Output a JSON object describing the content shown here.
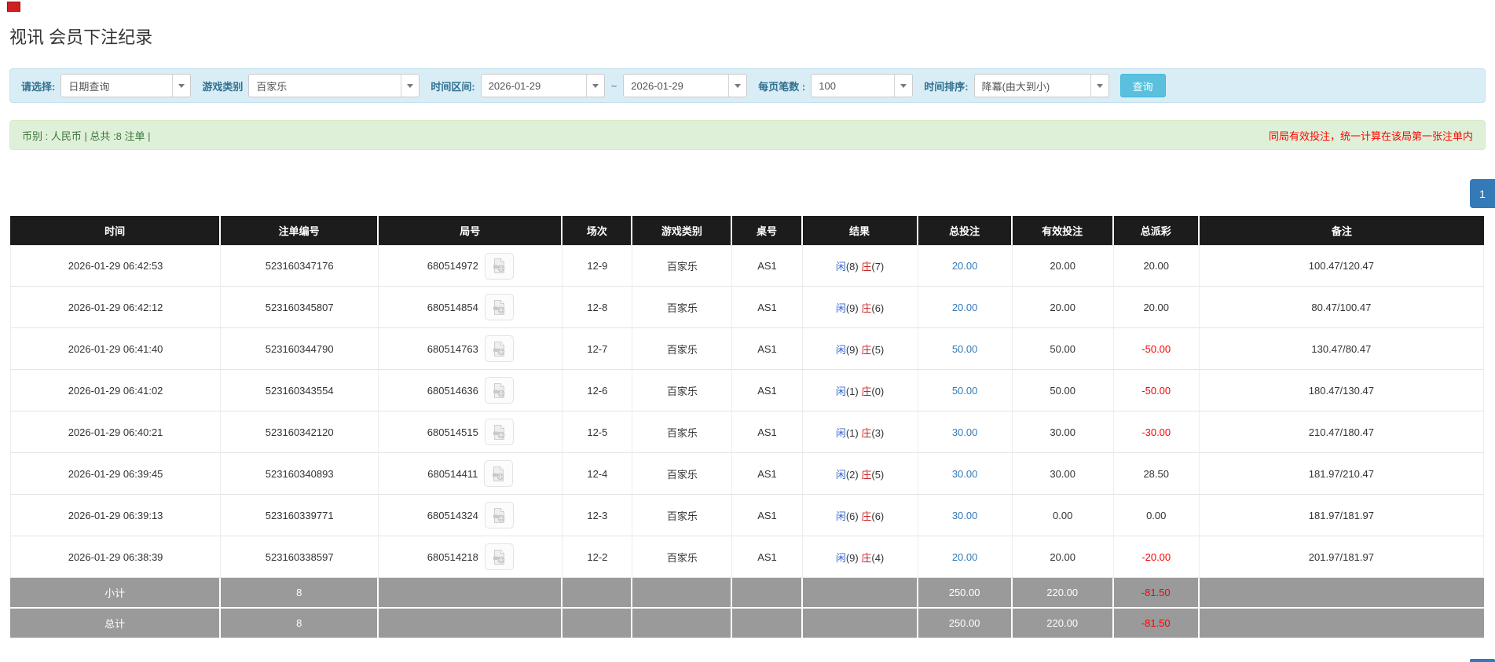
{
  "page": {
    "title": "视讯 会员下注纪录"
  },
  "colors": {
    "accent_blue": "#337ab7",
    "query_button_blue": "#5bc0de",
    "filterbar_bg": "#d9edf7",
    "infobar_bg": "#dff0d8",
    "header_bg": "#1c1c1c",
    "sum_row_gray": "#9a9a9a",
    "negative_red": "#ff0000",
    "player_blue": "#3366cc",
    "banker_red": "#cc2222"
  },
  "filters": {
    "select_label": "请选择:",
    "select_value": "日期查询",
    "game_label": "游戏类别",
    "game_value": "百家乐",
    "range_label": "时间区间:",
    "date_from": "2026-01-29",
    "tilde": "~",
    "date_to": "2026-01-29",
    "per_page_label": "每页笔数 :",
    "per_page_value": "100",
    "sort_label": "时间排序:",
    "sort_value": "降冪(由大到小)",
    "query_button": "查询"
  },
  "summary_bar": {
    "left": "币别 : 人民币 | 总共 :8 注单 |",
    "right": "同局有效投注，统一计算在该局第一张注单内"
  },
  "pagination": {
    "page": "1"
  },
  "table": {
    "headers": [
      "时间",
      "注单编号",
      "局号",
      "场次",
      "游戏类别",
      "桌号",
      "结果",
      "总投注",
      "有效投注",
      "总派彩",
      "备注"
    ],
    "rows": [
      {
        "time": "2026-01-29 06:42:53",
        "bet_id": "523160347176",
        "round_id": "680514972",
        "session": "12-9",
        "game": "百家乐",
        "table_no": "AS1",
        "result_player": "闲",
        "result_player_score": "(8)",
        "result_banker": "庄",
        "result_banker_score": "(7)",
        "total_bet": "20.00",
        "valid_bet": "20.00",
        "payout": "20.00",
        "remark": "100.47/120.47"
      },
      {
        "time": "2026-01-29 06:42:12",
        "bet_id": "523160345807",
        "round_id": "680514854",
        "session": "12-8",
        "game": "百家乐",
        "table_no": "AS1",
        "result_player": "闲",
        "result_player_score": "(9)",
        "result_banker": "庄",
        "result_banker_score": "(6)",
        "total_bet": "20.00",
        "valid_bet": "20.00",
        "payout": "20.00",
        "remark": "80.47/100.47"
      },
      {
        "time": "2026-01-29 06:41:40",
        "bet_id": "523160344790",
        "round_id": "680514763",
        "session": "12-7",
        "game": "百家乐",
        "table_no": "AS1",
        "result_player": "闲",
        "result_player_score": "(9)",
        "result_banker": "庄",
        "result_banker_score": "(5)",
        "total_bet": "50.00",
        "valid_bet": "50.00",
        "payout": "-50.00",
        "remark": "130.47/80.47"
      },
      {
        "time": "2026-01-29 06:41:02",
        "bet_id": "523160343554",
        "round_id": "680514636",
        "session": "12-6",
        "game": "百家乐",
        "table_no": "AS1",
        "result_player": "闲",
        "result_player_score": "(1)",
        "result_banker": "庄",
        "result_banker_score": "(0)",
        "total_bet": "50.00",
        "valid_bet": "50.00",
        "payout": "-50.00",
        "remark": "180.47/130.47"
      },
      {
        "time": "2026-01-29 06:40:21",
        "bet_id": "523160342120",
        "round_id": "680514515",
        "session": "12-5",
        "game": "百家乐",
        "table_no": "AS1",
        "result_player": "闲",
        "result_player_score": "(1)",
        "result_banker": "庄",
        "result_banker_score": "(3)",
        "total_bet": "30.00",
        "valid_bet": "30.00",
        "payout": "-30.00",
        "remark": "210.47/180.47"
      },
      {
        "time": "2026-01-29 06:39:45",
        "bet_id": "523160340893",
        "round_id": "680514411",
        "session": "12-4",
        "game": "百家乐",
        "table_no": "AS1",
        "result_player": "闲",
        "result_player_score": "(2)",
        "result_banker": "庄",
        "result_banker_score": "(5)",
        "total_bet": "30.00",
        "valid_bet": "30.00",
        "payout": "28.50",
        "remark": "181.97/210.47"
      },
      {
        "time": "2026-01-29 06:39:13",
        "bet_id": "523160339771",
        "round_id": "680514324",
        "session": "12-3",
        "game": "百家乐",
        "table_no": "AS1",
        "result_player": "闲",
        "result_player_score": "(6)",
        "result_banker": "庄",
        "result_banker_score": "(6)",
        "total_bet": "30.00",
        "valid_bet": "0.00",
        "payout": "0.00",
        "remark": "181.97/181.97"
      },
      {
        "time": "2026-01-29 06:38:39",
        "bet_id": "523160338597",
        "round_id": "680514218",
        "session": "12-2",
        "game": "百家乐",
        "table_no": "AS1",
        "result_player": "闲",
        "result_player_score": "(9)",
        "result_banker": "庄",
        "result_banker_score": "(4)",
        "total_bet": "20.00",
        "valid_bet": "20.00",
        "payout": "-20.00",
        "remark": "201.97/181.97"
      }
    ],
    "subtotal": {
      "label": "小计",
      "count": "8",
      "total_bet": "250.00",
      "valid_bet": "220.00",
      "payout": "-81.50"
    },
    "total": {
      "label": "总计",
      "count": "8",
      "total_bet": "250.00",
      "valid_bet": "220.00",
      "payout": "-81.50"
    }
  }
}
